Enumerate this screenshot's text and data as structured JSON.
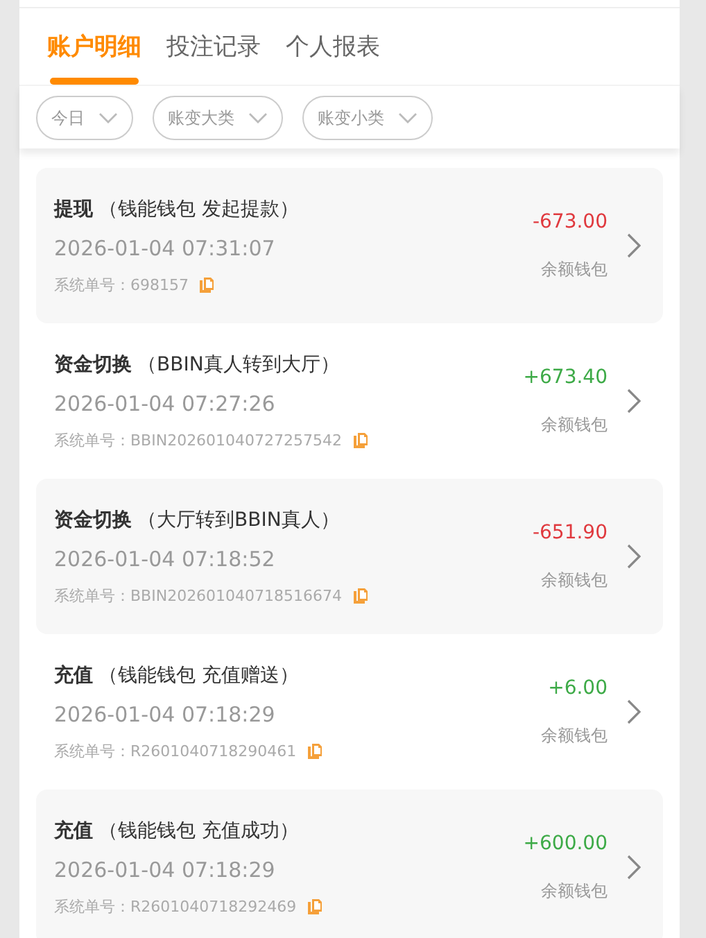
{
  "tabs": [
    {
      "label": "账户明细",
      "selected": true
    },
    {
      "label": "投注记录",
      "selected": false
    },
    {
      "label": "个人报表",
      "selected": false
    }
  ],
  "filters": [
    {
      "label": "今日"
    },
    {
      "label": "账变大类"
    },
    {
      "label": "账变小类"
    }
  ],
  "records": [
    {
      "type": "提现",
      "detail": "（钱能钱包 发起提款）",
      "time": "2026-01-04 07:31:07",
      "order": "系统单号：698157",
      "amount": "-673.00",
      "kind": "debit",
      "wallet": "余额钱包"
    },
    {
      "type": "资金切换",
      "detail": "（BBIN真人转到大厅）",
      "time": "2026-01-04 07:27:26",
      "order": "系统单号：BBIN202601040727257542",
      "amount": "+673.40",
      "kind": "credit",
      "wallet": "余额钱包"
    },
    {
      "type": "资金切换",
      "detail": "（大厅转到BBIN真人）",
      "time": "2026-01-04 07:18:52",
      "order": "系统单号：BBIN202601040718516674",
      "amount": "-651.90",
      "kind": "debit",
      "wallet": "余额钱包"
    },
    {
      "type": "充值",
      "detail": "（钱能钱包 充值赠送）",
      "time": "2026-01-04 07:18:29",
      "order": "系统单号：R2601040718290461",
      "amount": "+6.00",
      "kind": "credit",
      "wallet": "余额钱包"
    },
    {
      "type": "充值",
      "detail": "（钱能钱包 充值成功）",
      "time": "2026-01-04 07:18:29",
      "order": "系统单号：R2601040718292469",
      "amount": "+600.00",
      "kind": "credit",
      "wallet": "余额钱包"
    }
  ]
}
